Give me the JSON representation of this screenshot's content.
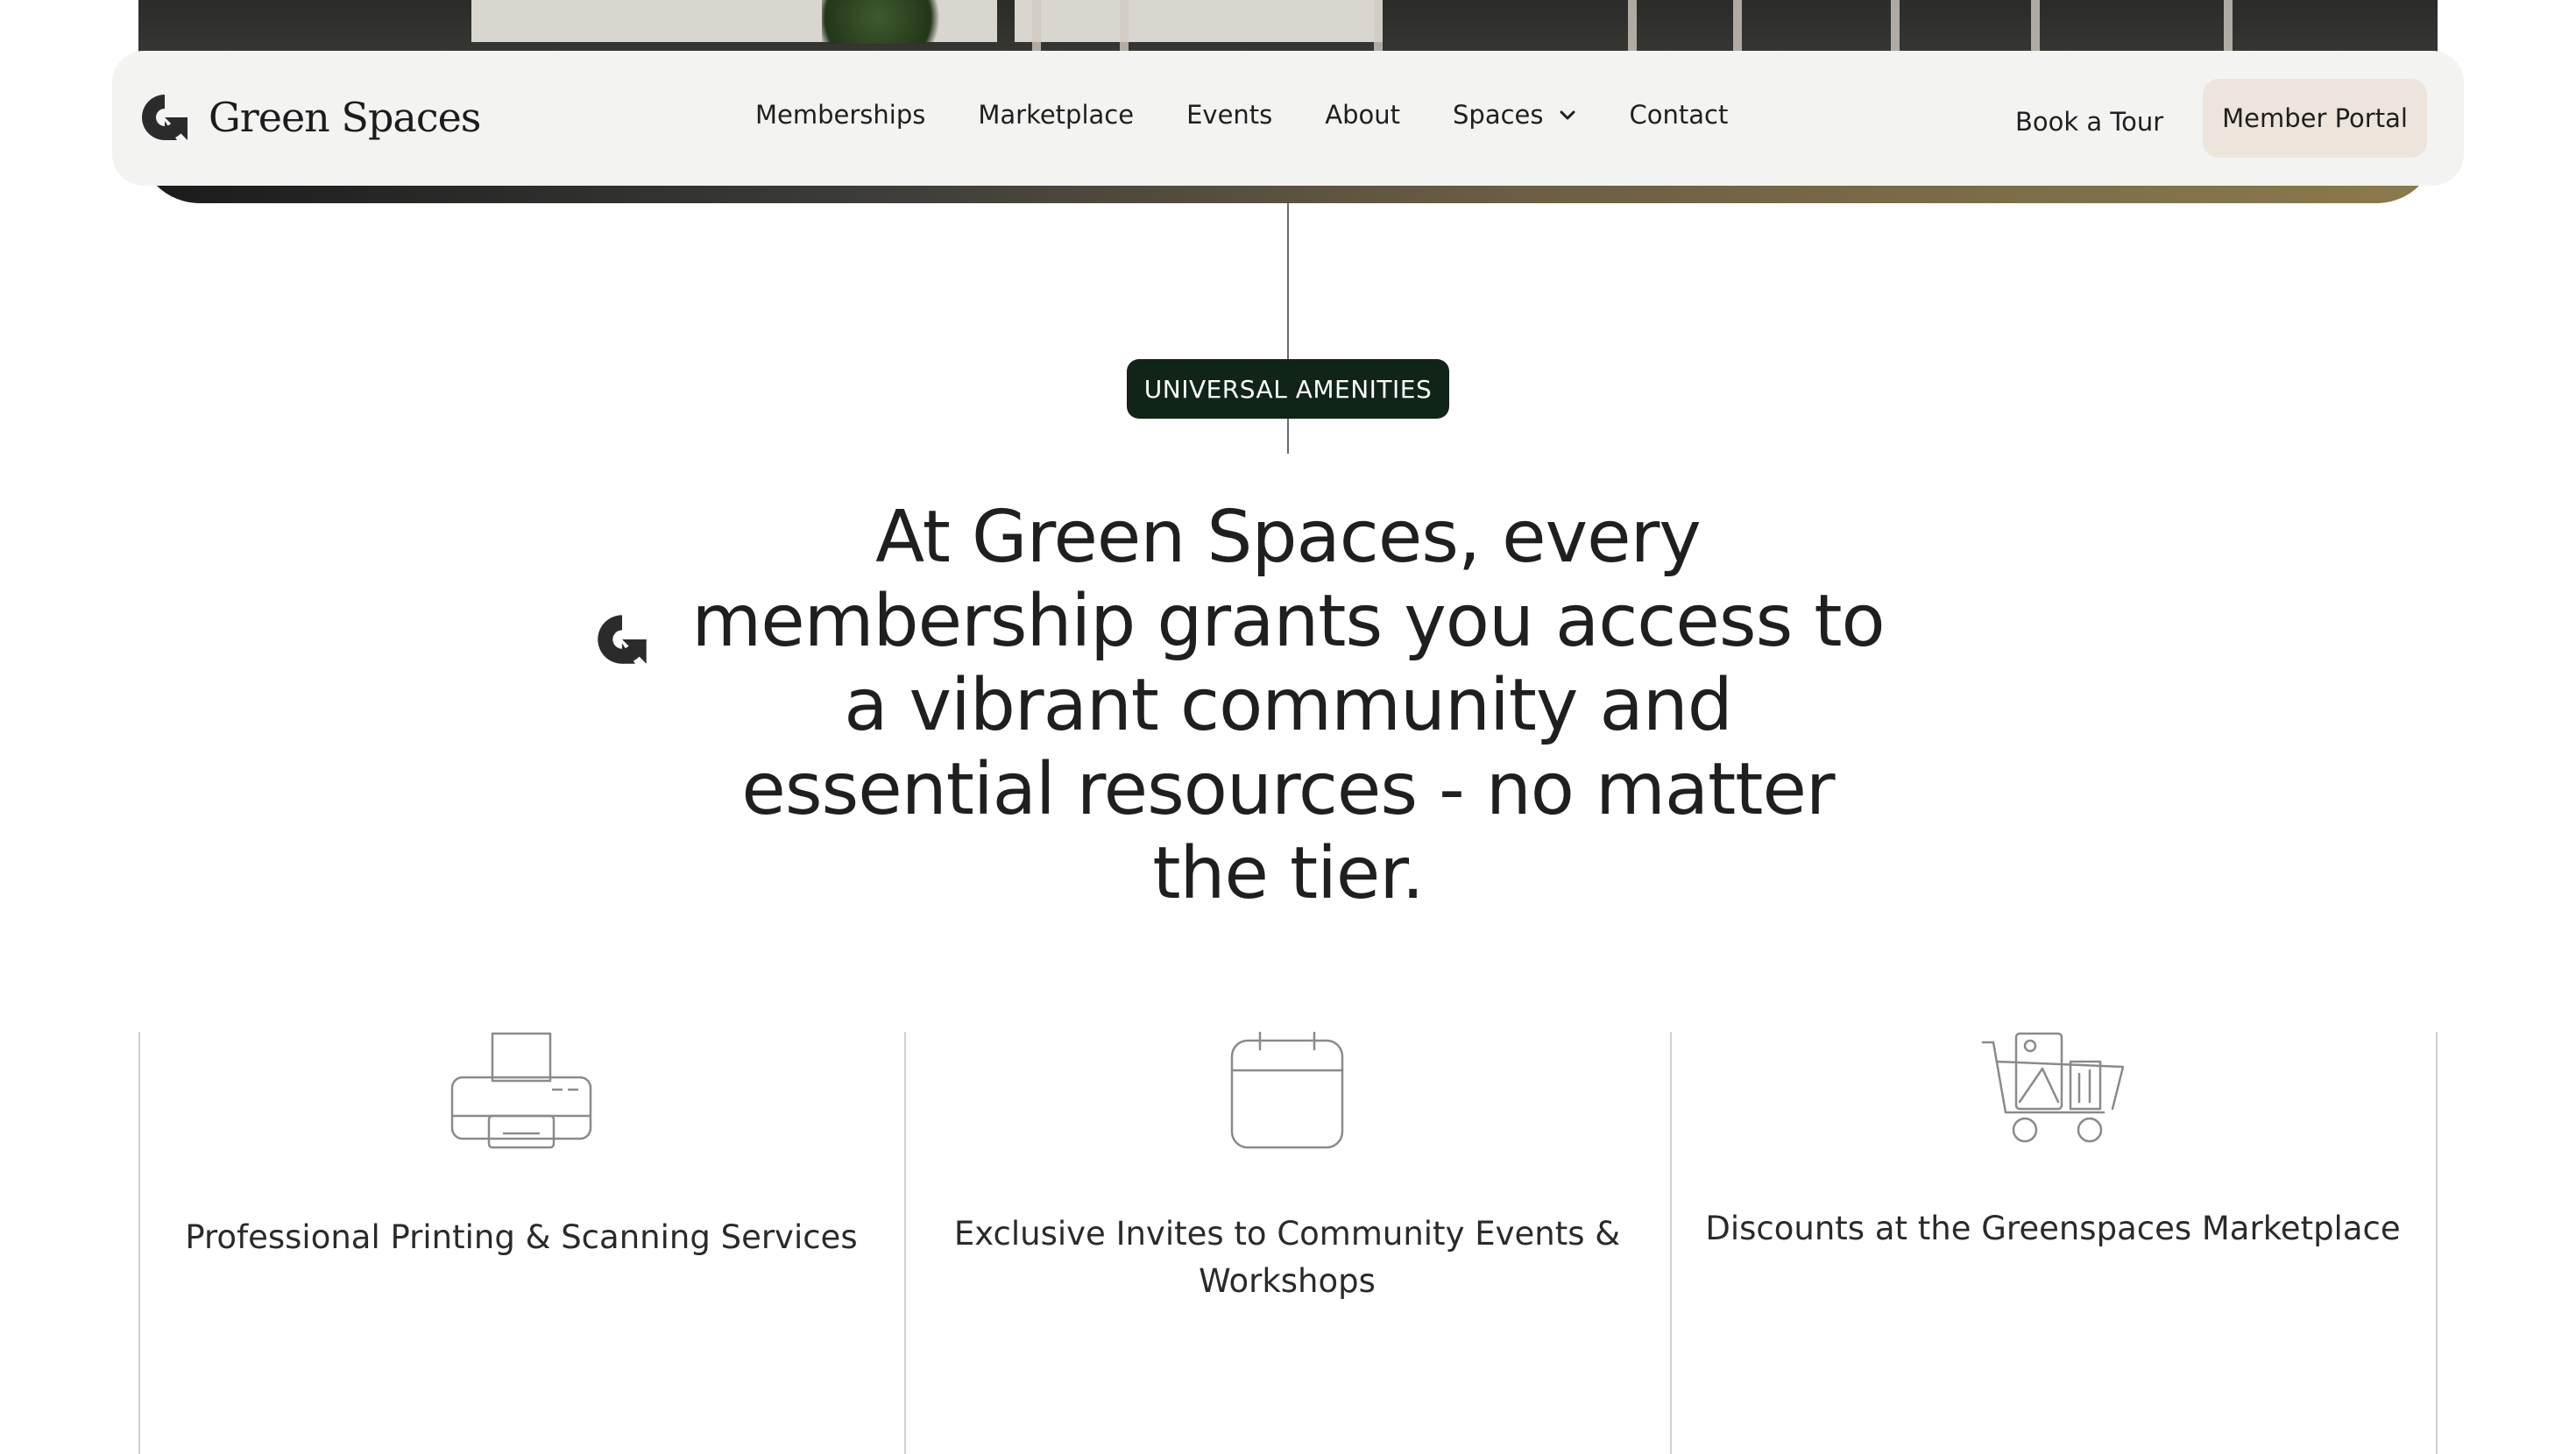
{
  "header": {
    "brand": "Green Spaces",
    "nav": [
      "Memberships",
      "Marketplace",
      "Events",
      "About",
      "Spaces",
      "Contact"
    ],
    "book_tour": "Book a Tour",
    "member_portal": "Member Portal"
  },
  "section": {
    "badge": "UNIVERSAL AMENITIES",
    "headline": "At Green Spaces, every membership grants you access to a vibrant community and essential resources - no matter the tier."
  },
  "amenities": [
    {
      "icon": "printer-icon",
      "label": "Professional Printing & Scanning Services"
    },
    {
      "icon": "calendar-icon",
      "label": "Exclusive Invites to Community Events & Workshops"
    },
    {
      "icon": "shopping-cart-icon",
      "label": "Discounts at the Greenspaces Marketplace"
    }
  ],
  "colors": {
    "badge_bg": "#102418",
    "portal_bg": "#ede5db",
    "nav_bg": "#f3f3f2"
  }
}
